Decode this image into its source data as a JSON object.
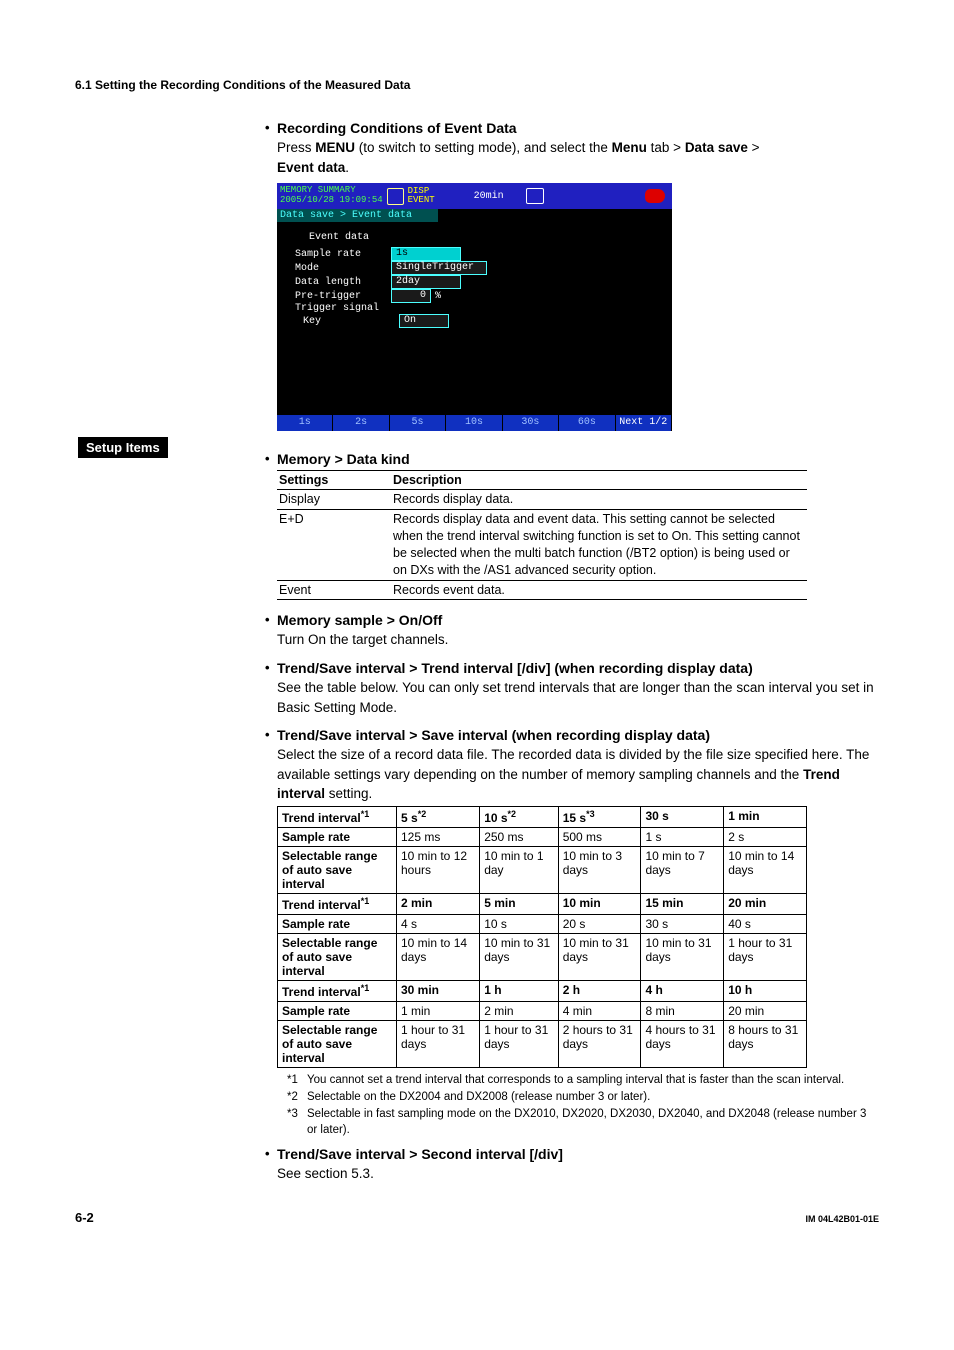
{
  "header": {
    "section": "6.1  Setting the Recording Conditions of the Measured Data"
  },
  "rec_conditions": {
    "title": "Recording Conditions of Event Data",
    "text_lead": "Press ",
    "menu1": "MENU",
    "text_mid1": " (to switch to setting mode), and select the ",
    "menu2": "Menu",
    "text_mid2": " tab > ",
    "ds": "Data save",
    "text_mid3": " > ",
    "ed": "Event data",
    "text_end": "."
  },
  "instrument": {
    "title_line1": "MEMORY SUMMARY",
    "title_line2": "2005/10/28 19:09:54",
    "disp": "DISP",
    "event": "EVENT",
    "timeind": "20min",
    "breadcrumb": "Data save > Event data",
    "group": "Event data",
    "rows": [
      {
        "label": "Sample rate",
        "value": "1s",
        "selected": true
      },
      {
        "label": "Mode",
        "value": "SingleTrigger"
      },
      {
        "label": "Data length",
        "value": "2day"
      },
      {
        "label": "Pre-trigger",
        "value": "0",
        "suffix": "%"
      },
      {
        "label": "Trigger signal",
        "value": ""
      },
      {
        "label": " Key",
        "value": "On",
        "indent": true
      }
    ],
    "softkeys": [
      "1s",
      "2s",
      "5s",
      "10s",
      "30s",
      "60s",
      "Next 1/2"
    ]
  },
  "setup_items_label": "Setup Items",
  "memory_data_kind": {
    "title": "Memory > Data kind",
    "col1": "Settings",
    "col2": "Description",
    "rows": [
      {
        "s": "Display",
        "d": "Records display data."
      },
      {
        "s": "E+D",
        "d": "Records display data and event data. This setting cannot be selected when the trend interval switching function is set to On. This setting cannot be selected when the multi batch function (/BT2 option) is being used or on DXs with the /AS1 advanced security option."
      },
      {
        "s": "Event",
        "d": "Records event data."
      }
    ]
  },
  "memory_sample": {
    "title": "Memory sample > On/Off",
    "text": "Turn On the target channels."
  },
  "trend_interval": {
    "title": "Trend/Save interval > Trend interval [/div] (when recording display data)",
    "text": "See the table below. You can only set trend intervals that are longer than the scan interval you set in Basic Setting Mode."
  },
  "save_interval": {
    "title": "Trend/Save interval > Save interval (when recording display data)",
    "text_p1": "Select the size of a record data file. The recorded data is divided by the file size specified here. The available settings vary depending on the number of memory sampling channels and the ",
    "ti": "Trend interval",
    "text_p2": " setting."
  },
  "giant_table": {
    "row_labels": [
      "Trend interval",
      "Sample rate",
      "Selectable range of auto save interval"
    ],
    "sup1": "*1",
    "blocks": [
      {
        "ti": [
          "5 s*2",
          "10 s*2",
          "15 s*3",
          "30 s",
          "1 min"
        ],
        "sr": [
          "125 ms",
          "250 ms",
          "500 ms",
          "1 s",
          "2 s"
        ],
        "rg": [
          "10 min to 12 hours",
          "10 min to 1 day",
          "10 min to 3 days",
          "10 min to 7 days",
          "10 min to 14 days"
        ]
      },
      {
        "ti": [
          "2 min",
          "5 min",
          "10 min",
          "15 min",
          "20 min"
        ],
        "sr": [
          "4 s",
          "10 s",
          "20 s",
          "30 s",
          "40 s"
        ],
        "rg": [
          "10 min to 14 days",
          "10 min to 31 days",
          "10 min to 31 days",
          "10 min to 31 days",
          "1 hour to 31 days"
        ]
      },
      {
        "ti": [
          "30 min",
          "1 h",
          "2 h",
          "4 h",
          "10 h"
        ],
        "sr": [
          "1 min",
          "2 min",
          "4 min",
          "8 min",
          "20 min"
        ],
        "rg": [
          "1 hour to 31 days",
          "1 hour to 31 days",
          "2 hours to 31 days",
          "4 hours to 31 days",
          "8 hours to 31 days"
        ]
      }
    ]
  },
  "footnotes": {
    "f1": "You cannot set a trend interval that corresponds to a sampling interval that is faster than the scan interval.",
    "f2": "Selectable on the DX2004 and DX2008 (release number 3 or later).",
    "f3": "Selectable in fast sampling mode on the DX2010, DX2020, DX2030, DX2040, and DX2048 (release number 3 or later)."
  },
  "second_interval": {
    "title": "Trend/Save interval > Second interval [/div]",
    "text": "See section 5.3."
  },
  "footer": {
    "page": "6-2",
    "docid": "IM 04L42B01-01E"
  }
}
